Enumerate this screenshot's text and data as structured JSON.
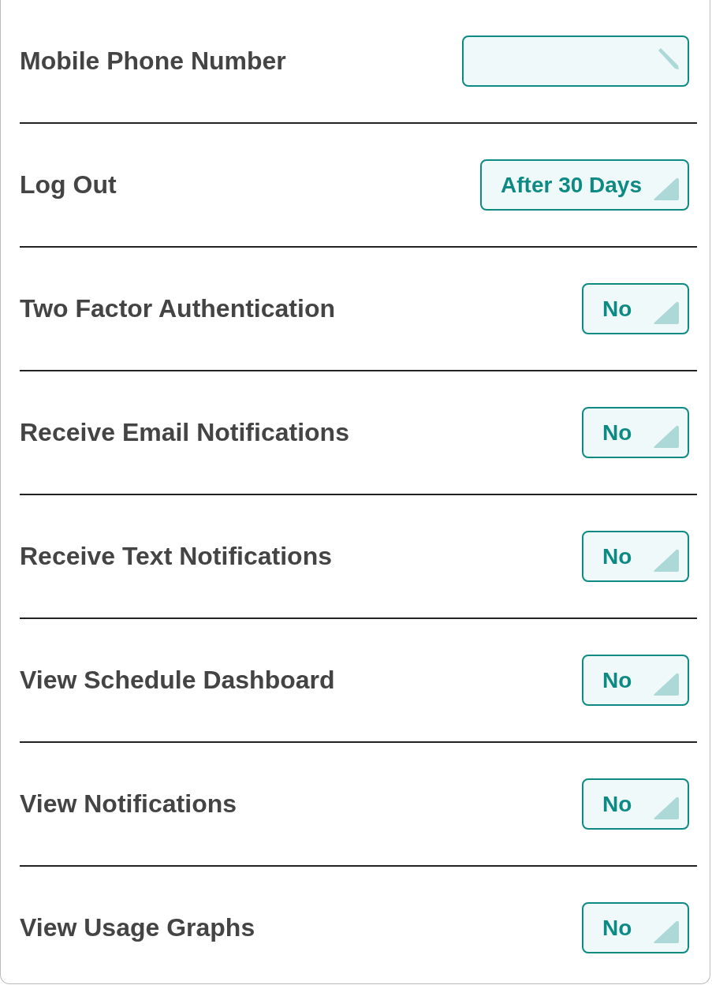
{
  "settings": [
    {
      "label": "Mobile Phone Number",
      "kind": "text"
    },
    {
      "label": "Log Out",
      "kind": "select",
      "value": "After 30 Days"
    },
    {
      "label": "Two Factor Authentication",
      "kind": "select",
      "value": "No"
    },
    {
      "label": "Receive Email Notifications",
      "kind": "select",
      "value": "No"
    },
    {
      "label": "Receive Text Notifications",
      "kind": "select",
      "value": "No"
    },
    {
      "label": "View Schedule Dashboard",
      "kind": "select",
      "value": "No"
    },
    {
      "label": "View Notifications",
      "kind": "select",
      "value": "No"
    },
    {
      "label": "View Usage Graphs",
      "kind": "select",
      "value": "No"
    }
  ]
}
